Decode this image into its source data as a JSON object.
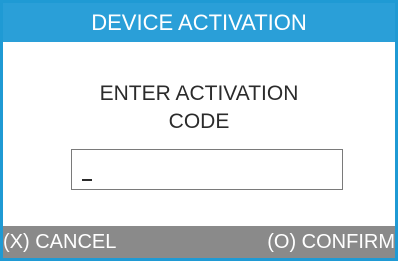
{
  "header": {
    "title": "DEVICE ACTIVATION"
  },
  "prompt": {
    "line1": "ENTER ACTIVATION",
    "line2": "CODE"
  },
  "activation_code": {
    "value": ""
  },
  "footer": {
    "cancel_label": "(X) CANCEL",
    "confirm_label": "(O) CONFIRM"
  },
  "colors": {
    "accent": "#2a9fd8",
    "footer_bg": "#8a8a8a",
    "text": "#2b2b2b"
  }
}
